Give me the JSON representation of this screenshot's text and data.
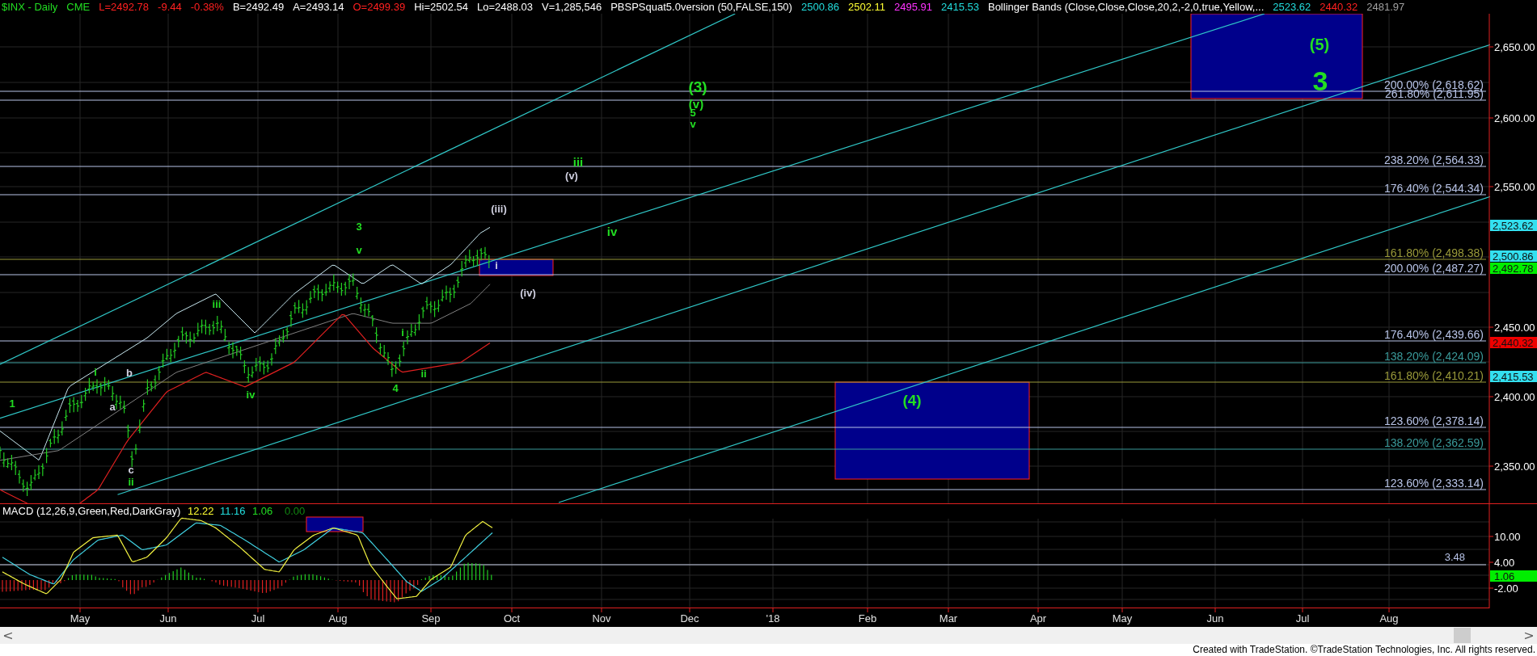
{
  "header": {
    "items": [
      {
        "text": "$INX - Daily",
        "color": "#22dd22"
      },
      {
        "text": "CME",
        "color": "#22dd22"
      },
      {
        "text": "L=2492.78",
        "color": "#ff2020"
      },
      {
        "text": "-9.44",
        "color": "#ff2020"
      },
      {
        "text": "-0.38%",
        "color": "#ff2020"
      },
      {
        "text": "B=2492.49",
        "color": "#ffffff"
      },
      {
        "text": "A=2493.14",
        "color": "#ffffff"
      },
      {
        "text": "O=2499.39",
        "color": "#ff2020"
      },
      {
        "text": "Hi=2502.54",
        "color": "#ffffff"
      },
      {
        "text": "Lo=2488.03",
        "color": "#ffffff"
      },
      {
        "text": "V=1,285,546",
        "color": "#ffffff"
      },
      {
        "text": "PBSPSquat5.0version (50,FALSE,150)",
        "color": "#ffffff"
      },
      {
        "text": "2500.86",
        "color": "#22dddd"
      },
      {
        "text": "2502.11",
        "color": "#ffff33"
      },
      {
        "text": "2495.91",
        "color": "#ff33ff"
      },
      {
        "text": "2415.53",
        "color": "#22dddd"
      },
      {
        "text": "Bollinger Bands (Close,Close,Close,20,2,-2,0,true,Yellow,...",
        "color": "#ffffff"
      },
      {
        "text": "2523.62",
        "color": "#22dddd"
      },
      {
        "text": "2440.32",
        "color": "#ff2020"
      },
      {
        "text": "2481.97",
        "color": "#a0a0a0"
      }
    ]
  },
  "fib_levels": [
    {
      "label": "200.00% (2,618.62)",
      "color": "#b8c4e8"
    },
    {
      "label": "261.80% (2,611.95)",
      "color": "#b8c4e8"
    },
    {
      "label": "238.20% (2,564.33)",
      "color": "#b8c4e8"
    },
    {
      "label": "176.40% (2,544.34)",
      "color": "#b8c4e8"
    },
    {
      "label": "161.80% (2,498.38)",
      "color": "#9a9a3a"
    },
    {
      "label": "200.00% (2,487.27)",
      "color": "#b8c4e8"
    },
    {
      "label": "176.40% (2,439.66)",
      "color": "#b8c4e8"
    },
    {
      "label": "138.20% (2,424.09)",
      "color": "#3a9a9a"
    },
    {
      "label": "161.80% (2,410.21)",
      "color": "#9a9a3a"
    },
    {
      "label": "123.60% (2,378.14)",
      "color": "#b8c4e8"
    },
    {
      "label": "138.20% (2,362.59)",
      "color": "#3a9a9a"
    },
    {
      "label": "123.60% (2,333.14)",
      "color": "#b8c4e8"
    }
  ],
  "wave_labels": [
    {
      "text": "1",
      "color": "#22dd22"
    },
    {
      "text": "i",
      "color": "#22dd22"
    },
    {
      "text": "b",
      "color": "#d0d0e0"
    },
    {
      "text": "a",
      "color": "#d0d0e0"
    },
    {
      "text": "c",
      "color": "#d0d0e0"
    },
    {
      "text": "ii",
      "color": "#22dd22"
    },
    {
      "text": "iii",
      "color": "#22dd22"
    },
    {
      "text": "iv",
      "color": "#22dd22"
    },
    {
      "text": "3",
      "color": "#22dd22"
    },
    {
      "text": "v",
      "color": "#22dd22"
    },
    {
      "text": "i",
      "color": "#22dd22"
    },
    {
      "text": "ii",
      "color": "#22dd22"
    },
    {
      "text": "4",
      "color": "#22dd22"
    },
    {
      "text": "i",
      "color": "#d0d0e0"
    },
    {
      "text": "(iii)",
      "color": "#d0d0e0"
    },
    {
      "text": "(iv)",
      "color": "#d0d0e0"
    },
    {
      "text": "iii",
      "color": "#22dd22"
    },
    {
      "text": "(v)",
      "color": "#d0d0e0"
    },
    {
      "text": "iv",
      "color": "#22dd22"
    },
    {
      "text": "(3)",
      "color": "#22dd22"
    },
    {
      "text": "(v)",
      "color": "#22dd22"
    },
    {
      "text": "5",
      "color": "#22dd22"
    },
    {
      "text": "v",
      "color": "#22dd22"
    },
    {
      "text": "3",
      "color": "#22dd22"
    },
    {
      "text": "(5)",
      "color": "#22dd22"
    },
    {
      "text": "(4)",
      "color": "#22dd22"
    }
  ],
  "price_axis": {
    "ticks": [
      "2,650.00",
      "2,600.00",
      "2,550.00",
      "2,450.00",
      "2,400.00",
      "2,350.00"
    ],
    "markers": [
      {
        "text": "2,523.62",
        "color": "#33e0f0"
      },
      {
        "text": "2,500.86",
        "color": "#33e0f0"
      },
      {
        "text": "2,492.78",
        "color": "#00ee00"
      },
      {
        "text": "2,440.32",
        "color": "#ee0000"
      },
      {
        "text": "2,415.53",
        "color": "#33e0f0"
      }
    ]
  },
  "macd": {
    "title": "MACD (12,26,9,Green,Red,DarkGray)",
    "values": [
      {
        "text": "12.22",
        "color": "#ffff33"
      },
      {
        "text": "11.16",
        "color": "#22dddd"
      },
      {
        "text": "1.06",
        "color": "#22dd22"
      },
      {
        "text": "0.00",
        "color": "#118811"
      }
    ],
    "level_label": "3.48",
    "ticks": [
      "10.00",
      "4.00",
      "-2.00"
    ],
    "marker": {
      "text": "1.06",
      "color": "#00ee00"
    }
  },
  "time_axis": [
    "May",
    "Jun",
    "Jul",
    "Aug",
    "Sep",
    "Oct",
    "Nov",
    "Dec",
    "'18",
    "Feb",
    "Mar",
    "Apr",
    "May",
    "Jun",
    "Jul",
    "Aug"
  ],
  "scrollbar": {
    "left": "<",
    "right": ">"
  },
  "footer": "Created with TradeStation. ©TradeStation Technologies, Inc. All rights reserved."
}
